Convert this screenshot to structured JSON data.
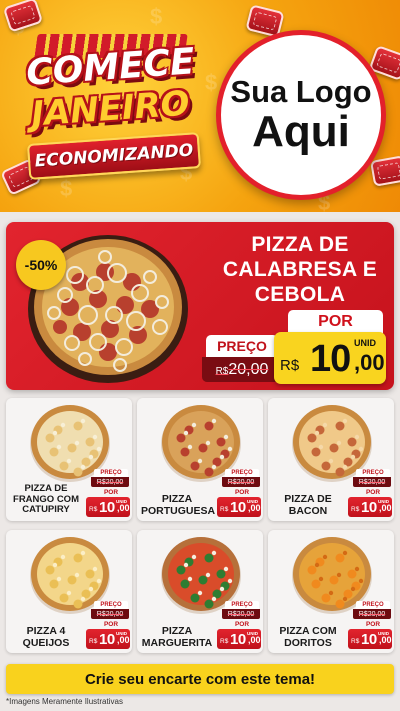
{
  "header": {
    "headline_line1": "COMECE",
    "headline_line2": "JANEIRO",
    "headline_line3": "ECONOMIZANDO",
    "logo_line1": "Sua Logo",
    "logo_line2": "Aqui"
  },
  "featured": {
    "discount": "-50%",
    "name_lines": [
      "PIZZA DE",
      "CALABRESA E",
      "CEBOLA"
    ],
    "preco_label": "PREÇO",
    "old_currency": "R$",
    "old_price": "20,00",
    "por_label": "POR",
    "unid_label": "UNID",
    "new_currency": "R$",
    "new_price_int": "10",
    "new_price_dec": ",00",
    "pizza_icon": "pizza-calabresa-cebola-image"
  },
  "price_tag": {
    "preco_label": "PREÇO",
    "old_price": "R$20,00",
    "por_label": "POR",
    "unid_label": "UNID",
    "currency": "R$",
    "price_int": "10",
    "price_dec": ",00"
  },
  "products": [
    {
      "name": "PIZZA DE FRANGO COM CATUPIRY",
      "image": "pizza-frango-catupiry-image"
    },
    {
      "name": "PIZZA PORTUGUESA",
      "image": "pizza-portuguesa-image"
    },
    {
      "name": "PIZZA DE BACON",
      "image": "pizza-bacon-image"
    },
    {
      "name": "PIZZA 4 QUEIJOS",
      "image": "pizza-4-queijos-image"
    },
    {
      "name": "PIZZA MARGUERITA",
      "image": "pizza-marguerita-image"
    },
    {
      "name": "PIZZA COM DORITOS",
      "image": "pizza-doritos-image"
    }
  ],
  "footer": {
    "cta": "Crie seu encarte com este tema!",
    "disclaimer": "*Imagens Meramente Ilustrativas"
  },
  "colors": {
    "brand_red": "#d0111c",
    "brand_yellow": "#f9d21d",
    "header_orange": "#f5a30f"
  }
}
